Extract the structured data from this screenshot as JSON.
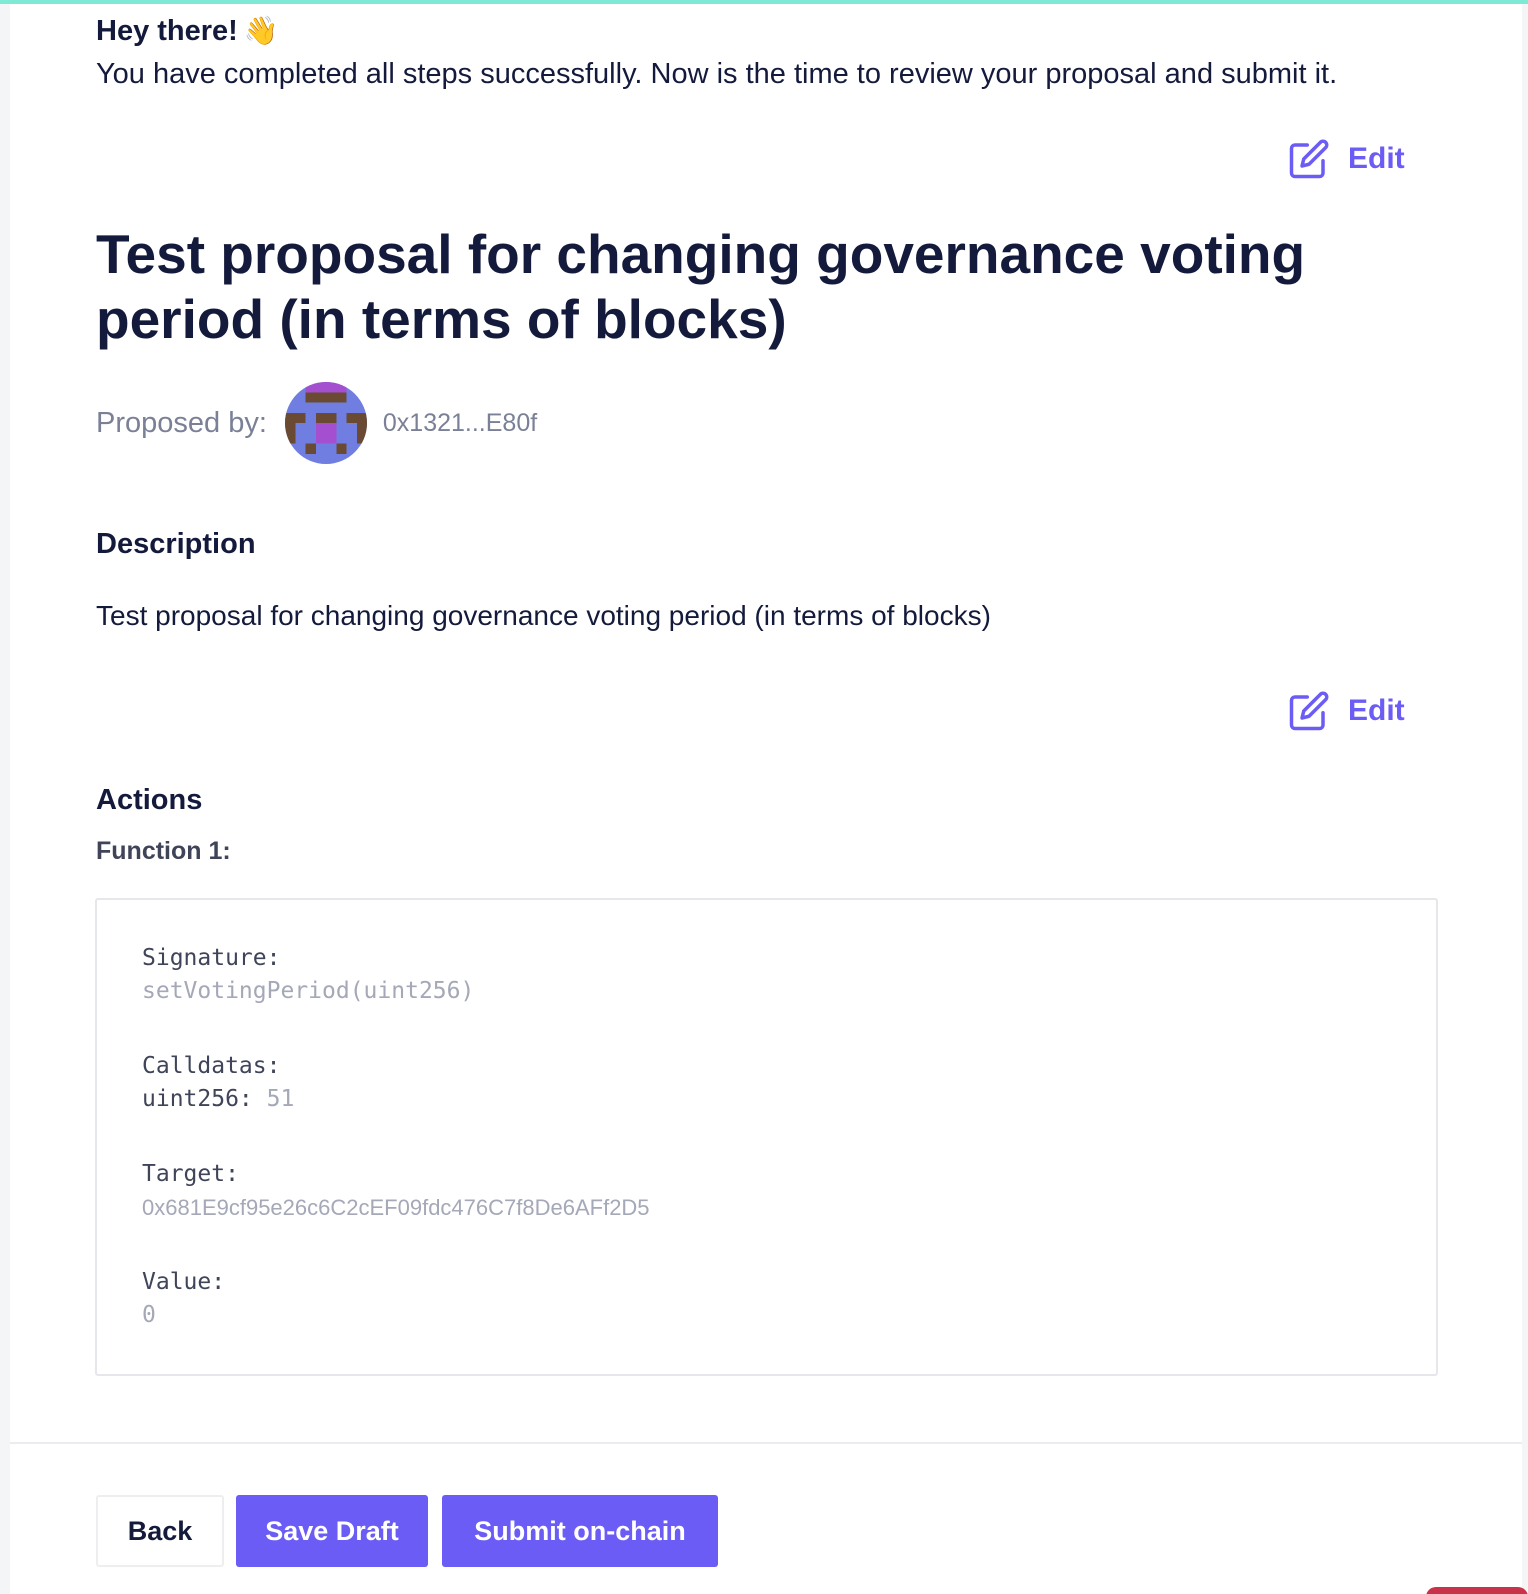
{
  "colors": {
    "accent": "#6b5cf6",
    "topline": "#7ee9d4",
    "text": "#141a3b",
    "muted": "#7a8096"
  },
  "greeting": {
    "title": "Hey there!",
    "emoji": "👋",
    "text": "You have completed all steps successfully. Now is the time to review your proposal and submit it."
  },
  "edit_label": "Edit",
  "proposal": {
    "title": "Test proposal for changing governance voting period (in terms of blocks)",
    "proposed_by_label": "Proposed by:",
    "proposer_address": "0x1321...E80f",
    "description_heading": "Description",
    "description": "Test proposal for changing governance voting period (in terms of blocks)"
  },
  "actions": {
    "heading": "Actions",
    "function_label": "Function 1:",
    "signature_label": "Signature:",
    "signature": "setVotingPeriod(uint256)",
    "calldatas_label": "Calldatas:",
    "calldata_type": "uint256:",
    "calldata_value": "51",
    "target_label": "Target:",
    "target": "0x681E9cf95e26c6C2cEF09fdc476C7f8De6AFf2D5",
    "value_label": "Value:",
    "value": "0"
  },
  "footer": {
    "back": "Back",
    "save_draft": "Save Draft",
    "submit": "Submit on-chain"
  }
}
